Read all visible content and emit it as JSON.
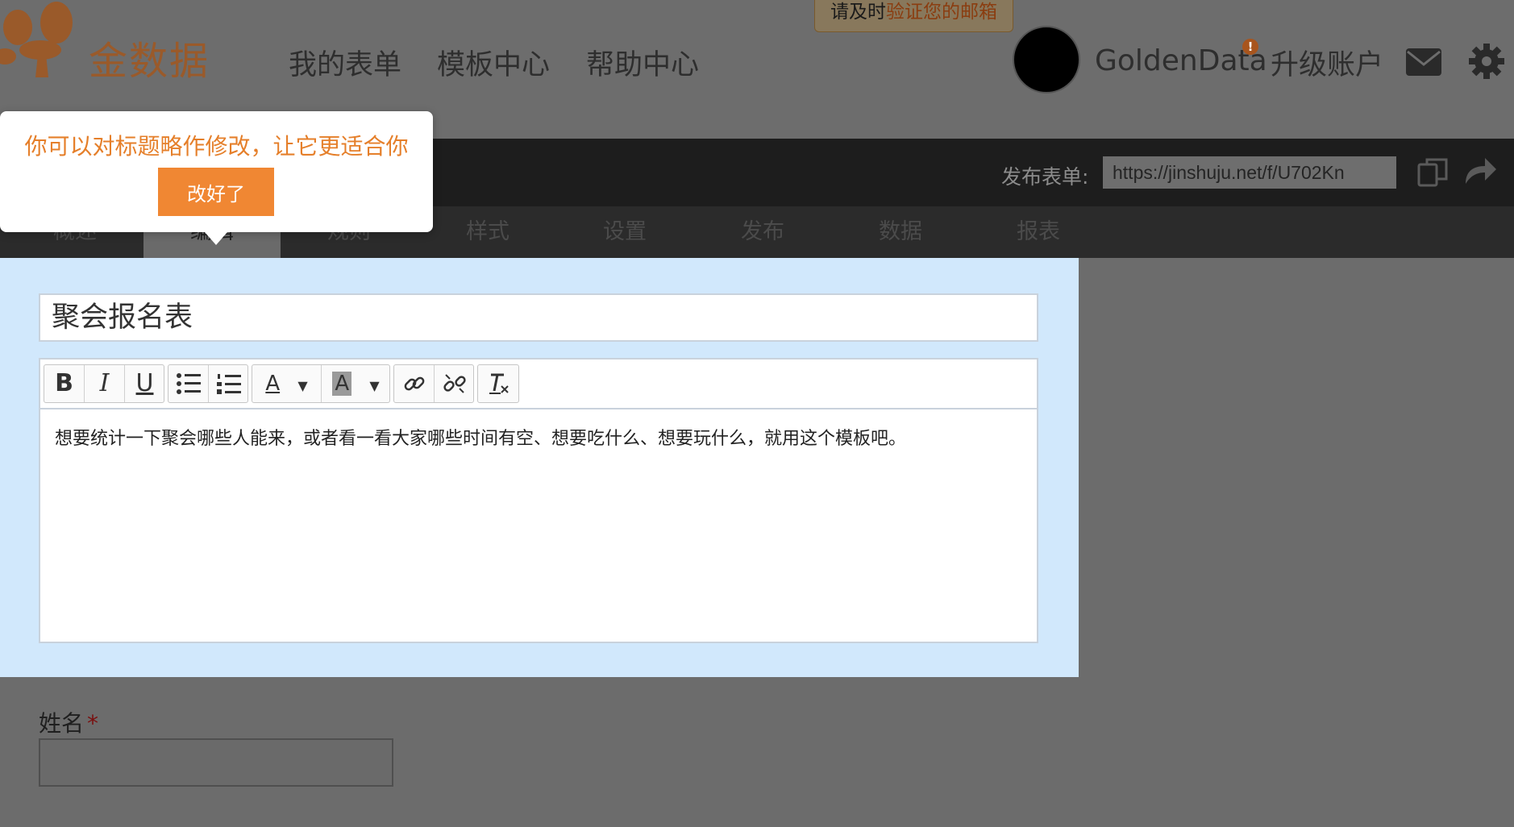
{
  "header": {
    "logo_text": "金数据",
    "nav": [
      "我的表单",
      "模板中心",
      "帮助中心"
    ],
    "verify_banner": {
      "prefix": "请及时",
      "link": "验证您的邮箱"
    },
    "username": "GoldenData",
    "alert_badge": "!",
    "upgrade_label": "升级账户"
  },
  "form_bar": {
    "publish_label": "发布表单:",
    "publish_url": "https://jinshuju.net/f/U702Kn"
  },
  "tabs": [
    "概述",
    "编辑",
    "规则",
    "样式",
    "设置",
    "发布",
    "数据",
    "报表"
  ],
  "active_tab": "编辑",
  "tooltip": {
    "text": "你可以对标题略作修改，让它更适合你",
    "button": "改好了"
  },
  "form": {
    "title": "聚会报名表",
    "description": "想要统计一下聚会哪些人能来，或者看一看大家哪些时间有空、想要吃什么、想要玩什么，就用这个模板吧。",
    "fields": [
      {
        "label": "姓名",
        "required_mark": "*"
      }
    ]
  },
  "editor_toolbar": {
    "bold": "B",
    "italic": "I",
    "underline": "U",
    "font_color": "A",
    "bg_color": "A"
  },
  "colors": {
    "accent": "#f08733",
    "tooltip_text": "#e57f2a",
    "panel_bg": "#d1e8fc",
    "overlay": "#6c6c6c"
  }
}
